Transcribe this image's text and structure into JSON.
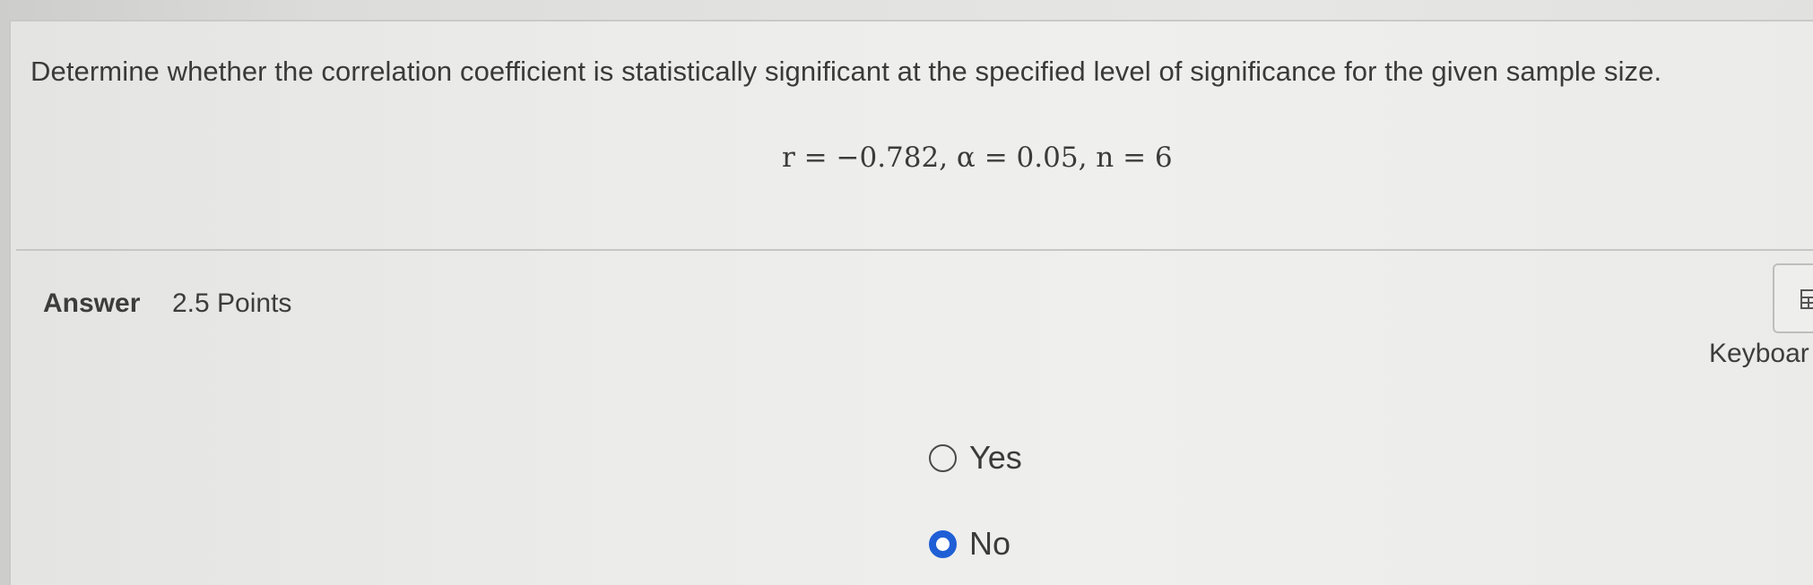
{
  "question": {
    "prompt": "Determine whether the correlation coefficient is statistically significant at the specified level of significance for the given sample size.",
    "formula": "r = −0.782, α = 0.05, n = 6"
  },
  "answer": {
    "label": "Answer",
    "points": "2.5 Points"
  },
  "keyboard": {
    "label": "Keyboar",
    "icon": "keyboard-icon"
  },
  "options": [
    {
      "label": "Yes",
      "selected": false
    },
    {
      "label": "No",
      "selected": true
    }
  ],
  "colors": {
    "selected_radio": "#1f5fd6"
  }
}
